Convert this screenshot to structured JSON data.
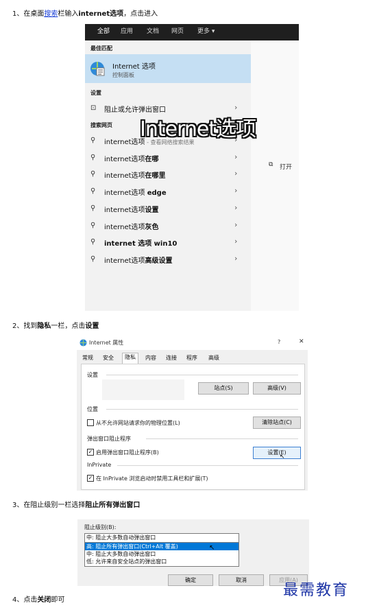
{
  "steps": {
    "s1_pre": "1、在桌面",
    "s1_link": "搜索",
    "s1_mid": "栏输入",
    "s1_bold": "internet选项",
    "s1_post": "，点击进入",
    "s2_pre": "2、找到",
    "s2_b1": "隐私",
    "s2_mid": "一栏，点击",
    "s2_b2": "设置",
    "s3_pre": "3、在阻止级别一栏选择",
    "s3_bold": "阻止所有弹出窗口",
    "s4_pre": "4、点击",
    "s4_bold": "关闭",
    "s4_post": "即可"
  },
  "search": {
    "tabs": [
      "全部",
      "应用",
      "文档",
      "网页",
      "更多 ▾"
    ],
    "best_match_header": "最佳匹配",
    "best_title": "Internet 选项",
    "best_subtitle": "控制面板",
    "settings_header": "设置",
    "settings_item": "阻止或允许弹出窗口",
    "web_header": "搜索网页",
    "overlay_caption": "Internet选项",
    "open_label": "打开",
    "results": [
      {
        "plain": "internet选项",
        "bold": "",
        "sub": " - 查看网络搜索结果"
      },
      {
        "plain": "internet选项",
        "bold": "在哪",
        "sub": ""
      },
      {
        "plain": "internet选项",
        "bold": "在哪里",
        "sub": ""
      },
      {
        "plain": "internet选项 ",
        "bold": "edge",
        "sub": ""
      },
      {
        "plain": "internet选项",
        "bold": "设置",
        "sub": ""
      },
      {
        "plain": "internet选项",
        "bold": "灰色",
        "sub": ""
      },
      {
        "plain": "",
        "bold": "internet 选项 win10",
        "sub": ""
      },
      {
        "plain": "internet选项",
        "bold": "高级设置",
        "sub": ""
      }
    ]
  },
  "props": {
    "title": "Internet 属性",
    "help": "?",
    "close": "✕",
    "tabs": [
      "常规",
      "安全",
      "隐私",
      "内容",
      "连接",
      "程序",
      "高级"
    ],
    "settings_label": "设置",
    "sites_btn": "站点(S)",
    "advanced_btn": "高级(V)",
    "location_label": "位置",
    "location_cb": "从不允许网站请求你的物理位置(L)",
    "clear_sites_btn": "清除站点(C)",
    "popup_label": "弹出窗口阻止程序",
    "popup_cb": "启用弹出窗口阻止程序(B)",
    "popup_settings_btn": "设置(E)",
    "inprivate_label": "InPrivate",
    "inprivate_cb": "在 InPrivate 浏览启动时禁用工具栏和扩展(T)"
  },
  "block": {
    "label": "阻止级别(B):",
    "current": "中: 阻止大多数自动弹出窗口",
    "options": [
      "高: 阻止所有弹出窗口(Ctrl+Alt 覆盖)",
      "中: 阻止大多数自动弹出窗口",
      "低: 允许来自安全站点的弹出窗口"
    ],
    "ok": "确定",
    "cancel": "取消",
    "apply": "应用(A)"
  },
  "watermark": "最需教育"
}
